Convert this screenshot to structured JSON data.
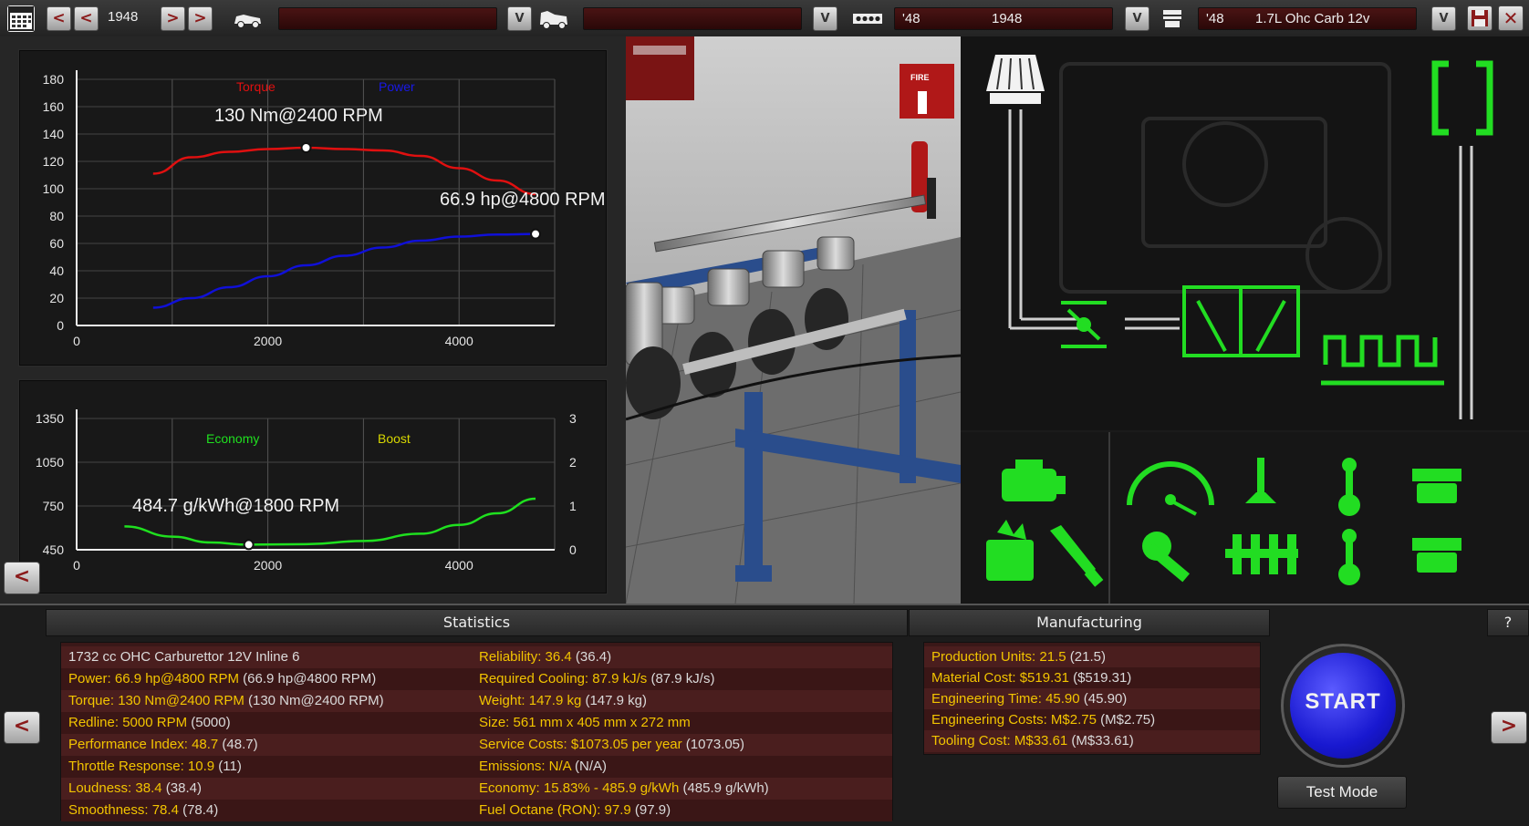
{
  "toolbar": {
    "year": "1948",
    "family_year_short": "'48",
    "family_year": "1948",
    "variant_year_short": "'48",
    "variant_name": "1.7L Ohc Carb 12v",
    "prev_label": "<",
    "next_label": ">",
    "dropdown_label": "V",
    "icons": [
      "calendar-icon",
      "car-icon",
      "van-icon",
      "engine-block-icon",
      "piston-head-icon",
      "save-icon",
      "close-icon"
    ]
  },
  "power_graph": {
    "legend_torque": "Torque",
    "legend_power": "Power",
    "torque_peak_label": "130 Nm@2400 RPM",
    "power_peak_label": "66.9 hp@4800 RPM",
    "y_ticks": [
      "180",
      "160",
      "140",
      "120",
      "100",
      "80",
      "60",
      "40",
      "20",
      "0"
    ],
    "x_ticks": [
      "0",
      "2000",
      "4000"
    ],
    "colors": {
      "torque": "#e01010",
      "power": "#1010d8"
    }
  },
  "economy_graph": {
    "legend_economy": "Economy",
    "legend_boost": "Boost",
    "economy_peak_label": "484.7 g/kWh@1800 RPM",
    "y_ticks_left": [
      "1350",
      "1050",
      "750",
      "450"
    ],
    "y_ticks_right": [
      "3",
      "2",
      "1",
      "0"
    ],
    "x_ticks": [
      "0",
      "2000",
      "4000"
    ],
    "colors": {
      "economy": "#1fe01f",
      "boost": "#d8d800"
    }
  },
  "chart_data": [
    {
      "type": "line",
      "xlim": [
        0,
        5000
      ],
      "ylim": [
        0,
        180
      ],
      "series": [
        {
          "name": "Torque",
          "x": [
            800,
            1200,
            1600,
            2000,
            2400,
            2800,
            3200,
            3600,
            4000,
            4400,
            4800
          ],
          "y": [
            111,
            123,
            127,
            129,
            130,
            129,
            128,
            124,
            115,
            106,
            96
          ]
        },
        {
          "name": "Power",
          "x": [
            800,
            1200,
            1600,
            2000,
            2400,
            2800,
            3200,
            3600,
            4000,
            4400,
            4800
          ],
          "y": [
            13,
            20,
            28,
            36,
            44,
            51,
            57,
            62,
            65,
            66.5,
            66.9
          ]
        }
      ]
    },
    {
      "type": "line",
      "xlim": [
        0,
        5000
      ],
      "ylim": [
        450,
        1350
      ],
      "series": [
        {
          "name": "Economy",
          "x": [
            500,
            1000,
            1400,
            1800,
            2400,
            3000,
            3600,
            4000,
            4400,
            4800
          ],
          "y": [
            610,
            540,
            500,
            485,
            488,
            510,
            560,
            620,
            700,
            800
          ]
        }
      ]
    }
  ],
  "layout_diagram_icons": [
    "air-filter-icon",
    "throttle-body-icon",
    "intake-manifold-icon",
    "exhaust-headers-icon",
    "exhaust-outlet-icon"
  ],
  "part_icons": [
    "engine-icon",
    "gauge-icon",
    "valve-icon",
    "conrod-icon",
    "piston-icon",
    "fuel-system-icon",
    "spark-plug-icon",
    "tuning-wrench-icon",
    "camshaft-icon",
    "conrod-icon",
    "piston-icon"
  ],
  "statistics": {
    "header": "Statistics",
    "col1": [
      {
        "label": "1732 cc OHC Carburettor 12V Inline 6",
        "paren": ""
      },
      {
        "label": "Power: 66.9 hp@4800 RPM",
        "paren": "(66.9 hp@4800 RPM)"
      },
      {
        "label": "Torque: 130 Nm@2400 RPM",
        "paren": "(130 Nm@2400 RPM)"
      },
      {
        "label": "Redline: 5000 RPM",
        "paren": "(5000)"
      },
      {
        "label": "Performance Index: 48.7",
        "paren": "(48.7)"
      },
      {
        "label": "Throttle Response: 10.9",
        "paren": "(11)"
      },
      {
        "label": "Loudness: 38.4",
        "paren": "(38.4)"
      },
      {
        "label": "Smoothness: 78.4",
        "paren": "(78.4)"
      }
    ],
    "col2": [
      {
        "label": "Reliability: 36.4",
        "paren": "(36.4)"
      },
      {
        "label": "Required Cooling: 87.9 kJ/s",
        "paren": "(87.9 kJ/s)"
      },
      {
        "label": "Weight: 147.9 kg",
        "paren": "(147.9 kg)"
      },
      {
        "label": "Size: 561 mm x 405 mm x 272 mm",
        "paren": ""
      },
      {
        "label": "Service Costs: $1073.05 per year",
        "paren": "(1073.05)"
      },
      {
        "label": "Emissions: N/A",
        "paren": "(N/A)"
      },
      {
        "label": "Economy: 15.83% - 485.9 g/kWh",
        "paren": "(485.9 g/kWh)"
      },
      {
        "label": "Fuel Octane (RON): 97.9",
        "paren": "(97.9)"
      }
    ]
  },
  "manufacturing": {
    "header": "Manufacturing",
    "rows": [
      {
        "label": "Production Units: 21.5",
        "paren": "(21.5)"
      },
      {
        "label": "Material Cost: $519.31",
        "paren": "($519.31)"
      },
      {
        "label": "Engineering Time: 45.90",
        "paren": "(45.90)"
      },
      {
        "label": "Engineering Costs: M$2.75",
        "paren": "(M$2.75)"
      },
      {
        "label": "Tooling Cost: M$33.61",
        "paren": "(M$33.61)"
      }
    ]
  },
  "actions": {
    "help_label": "?",
    "start_label": "START",
    "test_mode_label": "Test Mode",
    "back_label": "<",
    "prev_label": "<",
    "next_label": ">"
  }
}
